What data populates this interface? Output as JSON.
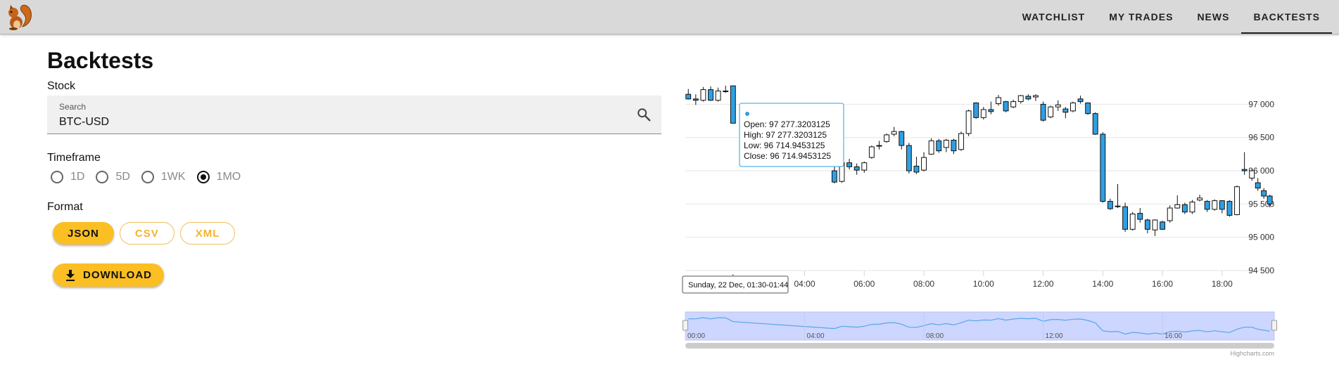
{
  "app": {
    "logo_icon": "squirrel-icon"
  },
  "nav": {
    "items": [
      {
        "label": "WATCHLIST",
        "active": false
      },
      {
        "label": "MY TRADES",
        "active": false
      },
      {
        "label": "NEWS",
        "active": false
      },
      {
        "label": "BACKTESTS",
        "active": true
      }
    ]
  },
  "page": {
    "title": "Backtests"
  },
  "stock": {
    "label": "Stock",
    "search_label": "Search",
    "value": "BTC-USD",
    "icon": "search-icon"
  },
  "timeframe": {
    "label": "Timeframe",
    "options": [
      "1D",
      "5D",
      "1WK",
      "1MO"
    ],
    "selected": "1MO"
  },
  "format": {
    "label": "Format",
    "options": [
      "JSON",
      "CSV",
      "XML"
    ],
    "selected": "JSON"
  },
  "download": {
    "label": "DOWNLOAD",
    "icon": "download-icon"
  },
  "colors": {
    "accent": "#fbbf24",
    "down_candle": "#2f9fe3",
    "navigator_fill": "#ccd6ff"
  },
  "chart_data": {
    "type": "candlestick",
    "y_ticks": [
      "94 500",
      "95 000",
      "95 500",
      "96 000",
      "96 500",
      "97 000"
    ],
    "ylim": [
      94500,
      97300
    ],
    "x_ticks": [
      "04:00",
      "06:00",
      "08:00",
      "10:00",
      "12:00",
      "14:00",
      "16:00",
      "18:00"
    ],
    "xlim": [
      0,
      19.75
    ],
    "tooltip": {
      "open": "Open: 97 277.3203125",
      "high": "High: 97 277.3203125",
      "low": "Low: 96 714.9453125",
      "close": "Close: 96 714.9453125"
    },
    "crosshair_label": "Sunday, 22 Dec, 01:30-01:44",
    "navigator_ticks": [
      "00:00",
      "04:00",
      "08:00",
      "12:00",
      "16:00"
    ],
    "credit": "Highcharts.com",
    "candles": [
      {
        "t": 0.1,
        "o": 97150,
        "h": 97230,
        "l": 97070,
        "c": 97080
      },
      {
        "t": 0.35,
        "o": 97080,
        "h": 97150,
        "l": 96990,
        "c": 97060
      },
      {
        "t": 0.6,
        "o": 97060,
        "h": 97260,
        "l": 97040,
        "c": 97220
      },
      {
        "t": 0.85,
        "o": 97220,
        "h": 97270,
        "l": 97050,
        "c": 97060
      },
      {
        "t": 1.1,
        "o": 97060,
        "h": 97250,
        "l": 97040,
        "c": 97200
      },
      {
        "t": 1.35,
        "o": 97200,
        "h": 97280,
        "l": 97170,
        "c": 97190
      },
      {
        "t": 1.6,
        "o": 97277,
        "h": 97277,
        "l": 96715,
        "c": 96715
      },
      {
        "t": 5.0,
        "o": 96000,
        "h": 96090,
        "l": 95810,
        "c": 95830
      },
      {
        "t": 5.25,
        "o": 95840,
        "h": 96150,
        "l": 95820,
        "c": 96120
      },
      {
        "t": 5.5,
        "o": 96120,
        "h": 96180,
        "l": 96020,
        "c": 96060
      },
      {
        "t": 5.75,
        "o": 96060,
        "h": 96110,
        "l": 95940,
        "c": 96010
      },
      {
        "t": 6.0,
        "o": 96010,
        "h": 96140,
        "l": 95970,
        "c": 96120
      },
      {
        "t": 6.25,
        "o": 96200,
        "h": 96380,
        "l": 96180,
        "c": 96360
      },
      {
        "t": 6.5,
        "o": 96370,
        "h": 96450,
        "l": 96320,
        "c": 96380
      },
      {
        "t": 6.75,
        "o": 96440,
        "h": 96560,
        "l": 96420,
        "c": 96540
      },
      {
        "t": 7.0,
        "o": 96550,
        "h": 96660,
        "l": 96520,
        "c": 96590
      },
      {
        "t": 7.25,
        "o": 96590,
        "h": 96600,
        "l": 96320,
        "c": 96380
      },
      {
        "t": 7.5,
        "o": 96380,
        "h": 96420,
        "l": 95960,
        "c": 96000
      },
      {
        "t": 7.75,
        "o": 96070,
        "h": 96210,
        "l": 95950,
        "c": 95980
      },
      {
        "t": 8.0,
        "o": 96010,
        "h": 96280,
        "l": 95990,
        "c": 96200
      },
      {
        "t": 8.25,
        "o": 96250,
        "h": 96490,
        "l": 96240,
        "c": 96450
      },
      {
        "t": 8.5,
        "o": 96450,
        "h": 96480,
        "l": 96270,
        "c": 96300
      },
      {
        "t": 8.75,
        "o": 96350,
        "h": 96480,
        "l": 96280,
        "c": 96460
      },
      {
        "t": 9.0,
        "o": 96460,
        "h": 96480,
        "l": 96250,
        "c": 96300
      },
      {
        "t": 9.25,
        "o": 96320,
        "h": 96590,
        "l": 96300,
        "c": 96560
      },
      {
        "t": 9.5,
        "o": 96560,
        "h": 96920,
        "l": 96520,
        "c": 96900
      },
      {
        "t": 9.75,
        "o": 97020,
        "h": 97030,
        "l": 96780,
        "c": 96800
      },
      {
        "t": 10.0,
        "o": 96800,
        "h": 96960,
        "l": 96770,
        "c": 96920
      },
      {
        "t": 10.25,
        "o": 96920,
        "h": 97040,
        "l": 96850,
        "c": 96890
      },
      {
        "t": 10.5,
        "o": 97010,
        "h": 97140,
        "l": 96980,
        "c": 97100
      },
      {
        "t": 10.75,
        "o": 97040,
        "h": 97050,
        "l": 96880,
        "c": 96900
      },
      {
        "t": 11.0,
        "o": 96960,
        "h": 97070,
        "l": 96940,
        "c": 97040
      },
      {
        "t": 11.25,
        "o": 97040,
        "h": 97140,
        "l": 97010,
        "c": 97130
      },
      {
        "t": 11.5,
        "o": 97120,
        "h": 97150,
        "l": 97060,
        "c": 97080
      },
      {
        "t": 11.75,
        "o": 97110,
        "h": 97150,
        "l": 97050,
        "c": 97130
      },
      {
        "t": 12.0,
        "o": 97000,
        "h": 97040,
        "l": 96740,
        "c": 96760
      },
      {
        "t": 12.25,
        "o": 96810,
        "h": 96980,
        "l": 96790,
        "c": 96960
      },
      {
        "t": 12.5,
        "o": 96960,
        "h": 97060,
        "l": 96900,
        "c": 96990
      },
      {
        "t": 12.75,
        "o": 96930,
        "h": 96960,
        "l": 96790,
        "c": 96880
      },
      {
        "t": 13.0,
        "o": 96900,
        "h": 97040,
        "l": 96880,
        "c": 97020
      },
      {
        "t": 13.25,
        "o": 97080,
        "h": 97130,
        "l": 97010,
        "c": 97040
      },
      {
        "t": 13.5,
        "o": 97020,
        "h": 97030,
        "l": 96840,
        "c": 96860
      },
      {
        "t": 13.75,
        "o": 96860,
        "h": 96880,
        "l": 96540,
        "c": 96550
      },
      {
        "t": 14.0,
        "o": 96550,
        "h": 96580,
        "l": 95520,
        "c": 95540
      },
      {
        "t": 14.25,
        "o": 95540,
        "h": 95580,
        "l": 95410,
        "c": 95430
      },
      {
        "t": 14.5,
        "o": 95460,
        "h": 95800,
        "l": 95440,
        "c": 95470
      },
      {
        "t": 14.75,
        "o": 95460,
        "h": 95520,
        "l": 95080,
        "c": 95120
      },
      {
        "t": 15.0,
        "o": 95120,
        "h": 95380,
        "l": 95100,
        "c": 95350
      },
      {
        "t": 15.25,
        "o": 95360,
        "h": 95440,
        "l": 95220,
        "c": 95270
      },
      {
        "t": 15.5,
        "o": 95260,
        "h": 95280,
        "l": 95060,
        "c": 95120
      },
      {
        "t": 15.75,
        "o": 95110,
        "h": 95270,
        "l": 95020,
        "c": 95260
      },
      {
        "t": 16.0,
        "o": 95230,
        "h": 95250,
        "l": 95110,
        "c": 95120
      },
      {
        "t": 16.25,
        "o": 95250,
        "h": 95480,
        "l": 95220,
        "c": 95440
      },
      {
        "t": 16.5,
        "o": 95440,
        "h": 95630,
        "l": 95430,
        "c": 95490
      },
      {
        "t": 16.75,
        "o": 95490,
        "h": 95520,
        "l": 95350,
        "c": 95380
      },
      {
        "t": 17.0,
        "o": 95380,
        "h": 95560,
        "l": 95350,
        "c": 95530
      },
      {
        "t": 17.25,
        "o": 95560,
        "h": 95640,
        "l": 95540,
        "c": 95590
      },
      {
        "t": 17.5,
        "o": 95540,
        "h": 95560,
        "l": 95380,
        "c": 95420
      },
      {
        "t": 17.75,
        "o": 95420,
        "h": 95570,
        "l": 95400,
        "c": 95550
      },
      {
        "t": 18.0,
        "o": 95550,
        "h": 95560,
        "l": 95360,
        "c": 95420
      },
      {
        "t": 18.25,
        "o": 95540,
        "h": 95560,
        "l": 95310,
        "c": 95330
      },
      {
        "t": 18.5,
        "o": 95340,
        "h": 95780,
        "l": 95330,
        "c": 95760
      },
      {
        "t": 18.75,
        "o": 96020,
        "h": 96280,
        "l": 95940,
        "c": 96000
      },
      {
        "t": 19.0,
        "o": 95890,
        "h": 96030,
        "l": 95850,
        "c": 96000
      },
      {
        "t": 19.2,
        "o": 95820,
        "h": 95890,
        "l": 95700,
        "c": 95740
      },
      {
        "t": 19.4,
        "o": 95700,
        "h": 95740,
        "l": 95580,
        "c": 95620
      },
      {
        "t": 19.6,
        "o": 95620,
        "h": 95640,
        "l": 95450,
        "c": 95500
      }
    ]
  }
}
